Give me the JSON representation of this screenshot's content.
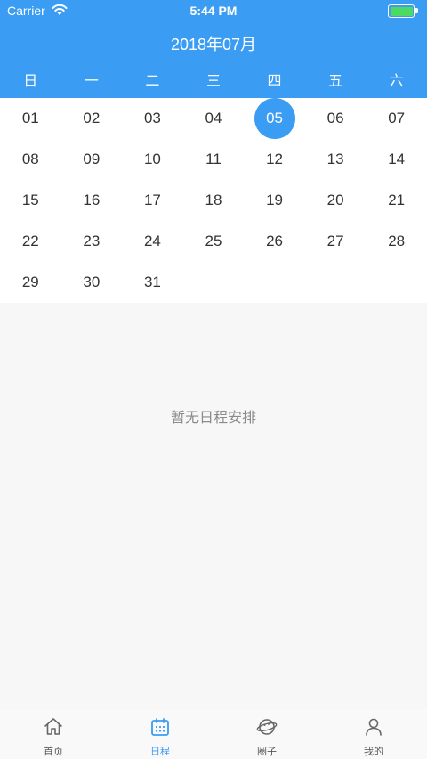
{
  "status_bar": {
    "carrier": "Carrier",
    "time": "5:44 PM"
  },
  "header": {
    "title": "2018年07月"
  },
  "weekdays": [
    "日",
    "一",
    "二",
    "三",
    "四",
    "五",
    "六"
  ],
  "days": [
    "01",
    "02",
    "03",
    "04",
    "05",
    "06",
    "07",
    "08",
    "09",
    "10",
    "11",
    "12",
    "13",
    "14",
    "15",
    "16",
    "17",
    "18",
    "19",
    "20",
    "21",
    "22",
    "23",
    "24",
    "25",
    "26",
    "27",
    "28",
    "29",
    "30",
    "31"
  ],
  "selected_day": "05",
  "empty_message": "暂无日程安排",
  "tabs": [
    {
      "label": "首页",
      "icon": "home-icon"
    },
    {
      "label": "日程",
      "icon": "calendar-icon",
      "active": true
    },
    {
      "label": "圈子",
      "icon": "planet-icon"
    },
    {
      "label": "我的",
      "icon": "user-icon"
    }
  ],
  "colors": {
    "accent": "#3a9cf2",
    "battery": "#4cd964"
  }
}
